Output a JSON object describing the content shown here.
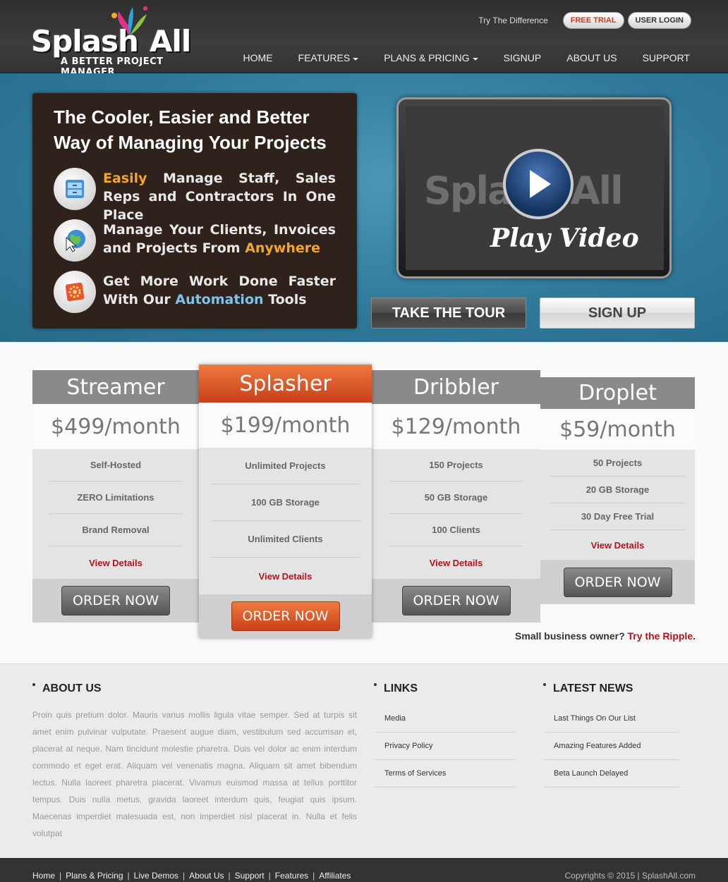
{
  "header": {
    "logo_word1": "Splash",
    "logo_word2": "All",
    "logo_tagline": "A BETTER PROJECT MANAGER",
    "try_text": "Try The Difference",
    "free_trial": "FREE TRIAL",
    "user_login": "USER LOGIN",
    "nav": [
      "HOME",
      "FEATURES",
      "PLANS & PRICING",
      "SIGNUP",
      "ABOUT US",
      "SUPPORT"
    ]
  },
  "hero": {
    "title": "The Cooler, Easier and Better Way of Managing Your Projects",
    "features": [
      {
        "icon": "cabinet-icon",
        "hl": "Easily",
        "rest": " Manage Staff, Sales Reps and Contractors In One Place"
      },
      {
        "icon": "globe-cursor-icon",
        "pre": "Manage Your Clients, Invoices and Projects From ",
        "hl": "Anywhere"
      },
      {
        "icon": "gear-icon",
        "pre": "Get More Work Done Faster With Our ",
        "hl": "Automation",
        "post": " Tools"
      }
    ],
    "video_bg_word": "Splash All",
    "play_label": "Play Video",
    "tour_button": "TAKE THE TOUR",
    "signup_button": "SIGN UP"
  },
  "plans": [
    {
      "name": "Streamer",
      "price": "$499/month",
      "features": [
        "Self-Hosted",
        "ZERO Limitations",
        "Brand Removal"
      ],
      "details": "View Details",
      "order": "ORDER NOW"
    },
    {
      "name": "Splasher",
      "price": "$199/month",
      "features": [
        "Unlimited Projects",
        "100 GB Storage",
        "Unlimited Clients"
      ],
      "details": "View Details",
      "order": "ORDER NOW"
    },
    {
      "name": "Dribbler",
      "price": "$129/month",
      "features": [
        "150 Projects",
        "50 GB Storage",
        "100 Clients"
      ],
      "details": "View Details",
      "order": "ORDER NOW"
    },
    {
      "name": "Droplet",
      "price": "$59/month",
      "features": [
        "50 Projects",
        "20 GB Storage",
        "30 Day Free Trial"
      ],
      "details": "View Details",
      "order": "ORDER NOW"
    }
  ],
  "ripple": {
    "text": "Small business owner?",
    "link": "Try the Ripple."
  },
  "footer": {
    "about_title": "ABOUT US",
    "about_text": "Proin quis pretium dolor. Mauris varius mollis ligula vitae semper. Sed at turpis sit amet enim pulvinar vulputate. Praesent augue diam, vestibulum sed accumsan et, placerat at neque. Nam tincidunt molestie pharetra. Duis vel dolor ac enim interdum commodo et eget erat. Aliquam vel venenatis magna. Aliquam sit amet bibendum lectus. Nulla laoreet pharetra placerat. Vivamus euismod massa at tellus porttitor tempus. Duis nulla metus, gravida laoreet interdum quis, feugiat quis ipsum. Maecenas imperdiet malesuada est, non imperdiet nisl placerat in. Nulla et felis volutpat",
    "links_title": "LINKS",
    "links": [
      "Media",
      "Privacy Policy",
      "Terms of Services"
    ],
    "news_title": "LATEST NEWS",
    "news": [
      "Last Things On Our List",
      "Amazing Features Added",
      "Beta Launch Delayed"
    ]
  },
  "bottom": {
    "nav": [
      "Home",
      "Plans & Pricing",
      "Live Demos",
      "About Us",
      "Support",
      "Features",
      "Affiliates"
    ],
    "copyright": "Copyrights © 2015 | SplashAll.com"
  }
}
